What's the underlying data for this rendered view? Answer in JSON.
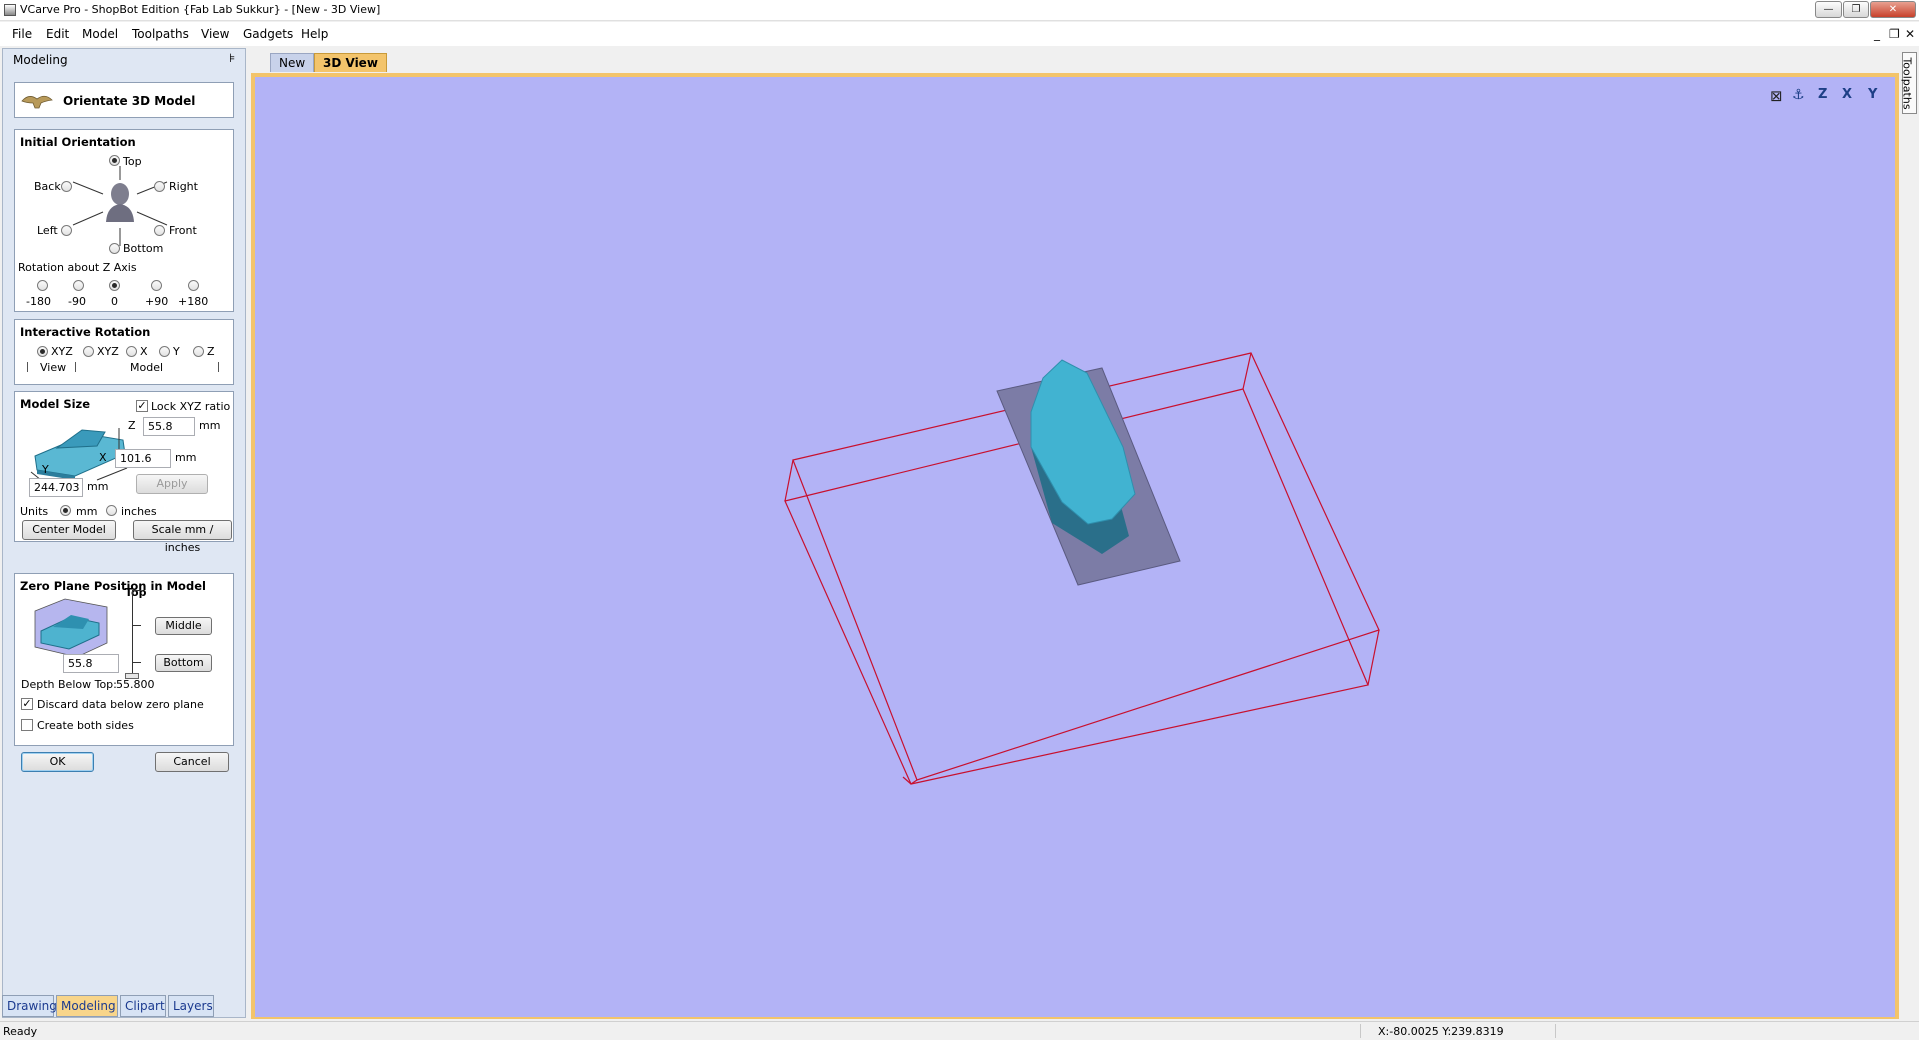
{
  "window": {
    "title": "VCarve Pro - ShopBot Edition {Fab Lab Sukkur} - [New - 3D View]",
    "controls": [
      "—",
      "❐",
      "✕"
    ]
  },
  "menu": [
    "File",
    "Edit",
    "Model",
    "Toolpaths",
    "View",
    "Gadgets",
    "Help"
  ],
  "mdi_controls": [
    "_",
    "❐",
    "✕"
  ],
  "panel": {
    "header": "Modeling",
    "pin": "⊧",
    "form_title": "Orientate 3D Model",
    "initial_orientation": {
      "title": "Initial Orientation",
      "options": {
        "top": "Top",
        "back": "Back",
        "right": "Right",
        "left": "Left",
        "front": "Front",
        "bottom": "Bottom"
      },
      "selected": "Top",
      "z_title": "Rotation about Z Axis",
      "z_options": [
        "-180",
        "-90",
        "0",
        "+90",
        "+180"
      ],
      "z_selected": "0"
    },
    "interactive_rotation": {
      "title": "Interactive Rotation",
      "options": [
        "XYZ",
        "XYZ",
        "X",
        "Y",
        "Z"
      ],
      "selected_index": 0,
      "group_view": "View",
      "group_model": "Model"
    },
    "model_size": {
      "title": "Model Size",
      "lock_label": "Lock XYZ ratio",
      "lock_checked": true,
      "z_label": "Z",
      "z_value": "55.8",
      "x_label": "X",
      "x_value": "101.6",
      "y_label": "Y",
      "y_value": "244.703",
      "unit": "mm",
      "apply": "Apply",
      "units_label": "Units",
      "unit_mm": "mm",
      "unit_inches": "inches",
      "units_selected": "mm",
      "center_model": "Center Model",
      "scale": "Scale mm / inches"
    },
    "zero_plane": {
      "title": "Zero Plane Position in Model",
      "top": "Top",
      "middle": "Middle",
      "bottom": "Bottom",
      "value": "55.8",
      "depth_label": "Depth Below Top:",
      "depth_value": "55.800",
      "discard_label": "Discard data below zero plane",
      "discard_checked": true,
      "both_sides_label": "Create both sides",
      "both_sides_checked": false
    },
    "ok": "OK",
    "cancel": "Cancel"
  },
  "bottom_tabs": [
    "Drawing",
    "Modeling",
    "Clipart",
    "Layers"
  ],
  "bottom_tab_active": "Modeling",
  "view_tabs": [
    "New",
    "3D View"
  ],
  "view_tab_active": "3D View",
  "side_tab": "Toolpaths",
  "view_icons": [
    "fit-view-icon",
    "iso-view-icon",
    "z-view-icon",
    "x-view-icon",
    "y-view-icon"
  ],
  "view_icon_labels": [
    "⊠",
    "⚓",
    "Z",
    "X",
    "Y"
  ],
  "status": {
    "text": "Ready",
    "coords": "X:-80.0025 Y:239.8319"
  },
  "colors": {
    "viewport_bg": "#b3b3f6",
    "viewport_border": "#f3c46b",
    "model_cyan": "#3fb0d0",
    "box_red": "#c8102e"
  }
}
